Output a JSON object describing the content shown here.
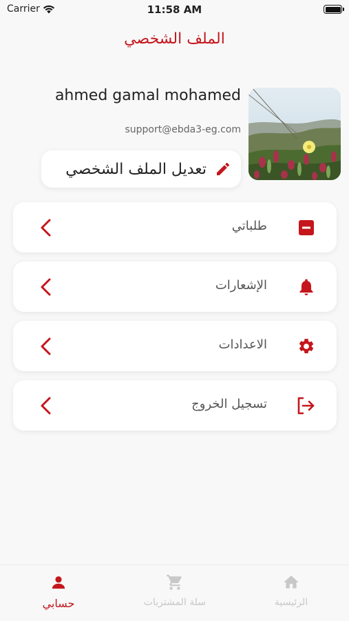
{
  "status_bar": {
    "carrier": "Carrier",
    "time": "11:58 AM"
  },
  "page_title": "الملف الشخصي",
  "profile": {
    "name": "ahmed gamal mohamed",
    "email": "support@ebda3-eg.com",
    "edit_label": "تعديل الملف الشخصي"
  },
  "menu": [
    {
      "label": "طلباتي",
      "icon": "minus-box-icon"
    },
    {
      "label": "الإشعارات",
      "icon": "bell-icon"
    },
    {
      "label": "الاعدادات",
      "icon": "gear-icon"
    },
    {
      "label": "تسجيل الخروج",
      "icon": "logout-icon"
    }
  ],
  "tabs": [
    {
      "label": "حسابي",
      "icon": "person-icon",
      "active": true
    },
    {
      "label": "سلة المشتريات",
      "icon": "cart-icon",
      "active": false
    },
    {
      "label": "الرئيسية",
      "icon": "home-icon",
      "active": false
    }
  ],
  "colors": {
    "accent": "#c4161c",
    "background": "#f8f8f8",
    "card": "#ffffff",
    "inactive": "#c8c8c8"
  }
}
